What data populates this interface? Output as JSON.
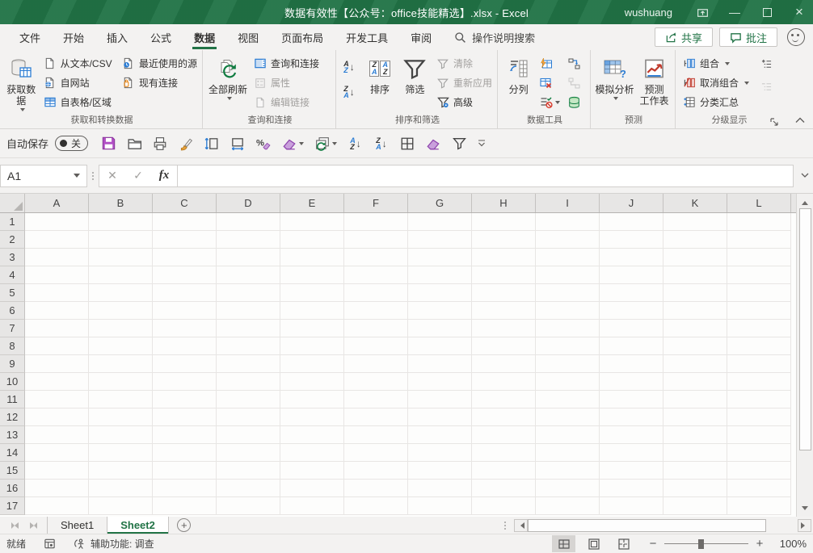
{
  "title_bar": {
    "title": "数据有效性【公众号：office技能精选】.xlsx - Excel",
    "user": "wushuang"
  },
  "tabs_row": {
    "file": "文件",
    "tabs": [
      "开始",
      "插入",
      "公式",
      "数据",
      "视图",
      "页面布局",
      "开发工具",
      "审阅"
    ],
    "active_tab": "数据",
    "search_label": "操作说明搜索",
    "share_label": "共享",
    "comments_label": "批注"
  },
  "ribbon": {
    "get_data": "获取数据",
    "from_text_csv": "从文本/CSV",
    "from_web": "自网站",
    "from_table_range": "自表格/区域",
    "recent_sources": "最近使用的源",
    "existing_connections": "现有连接",
    "group_get_transform": "获取和转换数据",
    "refresh_all": "全部刷新",
    "queries_connections": "查询和连接",
    "properties": "属性",
    "edit_links": "编辑链接",
    "group_queries": "查询和连接",
    "sort_label": "排序",
    "filter_label": "筛选",
    "clear_label": "清除",
    "reapply_label": "重新应用",
    "advanced_label": "高级",
    "group_sort_filter": "排序和筛选",
    "text_to_columns": "分列",
    "group_data_tools": "数据工具",
    "what_if": "模拟分析",
    "forecast_line1": "预测",
    "forecast_line2": "工作表",
    "group_forecast": "预测",
    "outline_group": "组合",
    "outline_ungroup": "取消组合",
    "subtotal": "分类汇总",
    "group_outline": "分级显示"
  },
  "icons": {
    "letter_a": "A",
    "letter_z": "Z",
    "arrow_down": "↓",
    "question": "?"
  },
  "qat": {
    "autosave_label": "自动保存",
    "autosave_state": "关"
  },
  "formula_bar": {
    "name_box_value": "A1",
    "fx_label": "fx",
    "formula_value": ""
  },
  "grid": {
    "columns": [
      "A",
      "B",
      "C",
      "D",
      "E",
      "F",
      "G",
      "H",
      "I",
      "J",
      "K",
      "L"
    ],
    "rows": [
      "1",
      "2",
      "3",
      "4",
      "5",
      "6",
      "7",
      "8",
      "9",
      "10",
      "11",
      "12",
      "13",
      "14",
      "15",
      "16",
      "17"
    ]
  },
  "sheet_bar": {
    "tabs": [
      {
        "name": "Sheet1",
        "active": false
      },
      {
        "name": "Sheet2",
        "active": true
      }
    ]
  },
  "status_bar": {
    "ready": "就绪",
    "accessibility": "辅助功能: 调查",
    "zoom_level": "100%"
  },
  "colors": {
    "excel_green": "#217346",
    "ribbon_bg": "#f3f2f1",
    "accent_blue": "#2b7cd3",
    "disabled": "#a19f9d"
  }
}
